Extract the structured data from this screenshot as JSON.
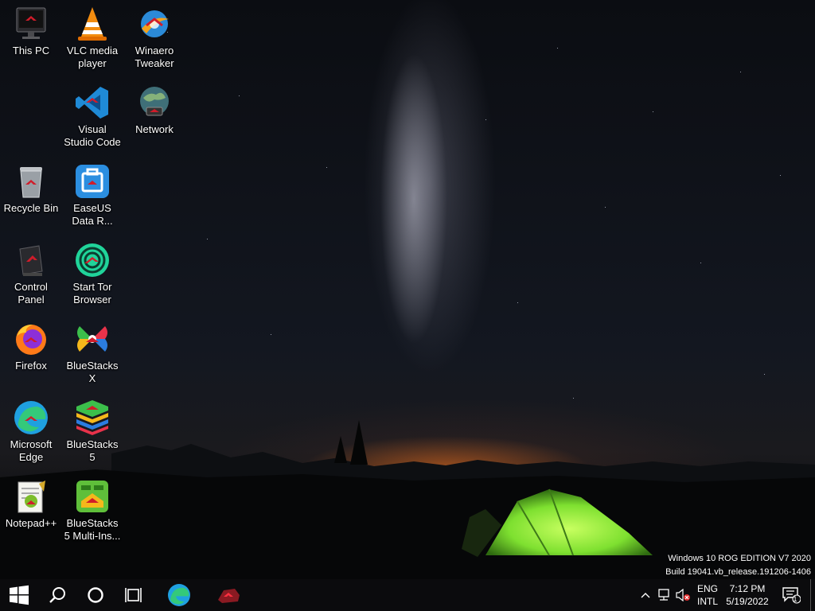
{
  "desktop_icons": [
    {
      "label": "This PC",
      "icon": "this-pc-icon"
    },
    {
      "label": "VLC media player",
      "icon": "vlc-icon"
    },
    {
      "label": "Winaero Tweaker",
      "icon": "winaero-icon"
    },
    {
      "label": "Visual Studio Code",
      "icon": "vscode-icon"
    },
    {
      "label": "Network",
      "icon": "network-icon"
    },
    {
      "label": "Recycle Bin",
      "icon": "recycle-bin-icon"
    },
    {
      "label": "EaseUS Data R...",
      "icon": "easeus-icon"
    },
    {
      "label": "Control Panel",
      "icon": "control-panel-icon"
    },
    {
      "label": "Start Tor Browser",
      "icon": "tor-icon"
    },
    {
      "label": "Firefox",
      "icon": "firefox-icon"
    },
    {
      "label": "BlueStacks X",
      "icon": "bluestacks-x-icon"
    },
    {
      "label": "Microsoft Edge",
      "icon": "edge-icon"
    },
    {
      "label": "BlueStacks 5",
      "icon": "bluestacks-5-icon"
    },
    {
      "label": "Notepad++",
      "icon": "notepadpp-icon"
    },
    {
      "label": "BlueStacks 5 Multi-Ins...",
      "icon": "bluestacks-multi-icon"
    }
  ],
  "watermark": {
    "line1": "Windows 10 ROG EDITION V7 2020",
    "line2": "Build 19041.vb_release.191206-1406"
  },
  "taskbar": {
    "start": "windows-logo-icon",
    "search": "search-icon",
    "cortana": "cortana-icon",
    "task_view": "task-view-icon",
    "pinned": [
      "edge-icon",
      "rog-icon"
    ],
    "tray": {
      "chevron": "chevron-up-icon",
      "network": "network-icon",
      "volume": "volume-muted-icon",
      "language": "ENG",
      "layout": "INTL",
      "time": "7:12 PM",
      "date": "5/19/2022",
      "notification_count": "1"
    }
  },
  "colors": {
    "taskbar_bg": "#0b0b0d",
    "horizon_glow": "#ff7a1e",
    "tent_green": "#7ee030"
  }
}
